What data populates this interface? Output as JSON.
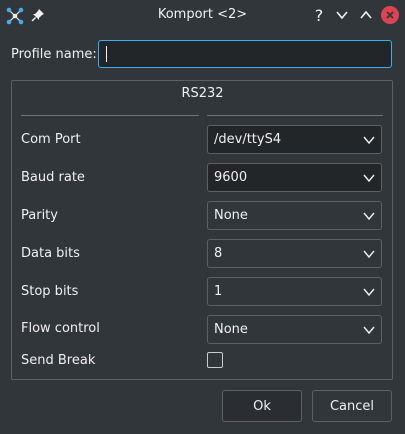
{
  "window": {
    "title": "Komport <2>",
    "app_icon": "network-icon",
    "pin_icon": "pin-icon",
    "help_label": "?",
    "colors": {
      "accent": "#3daee9",
      "close": "#da4453",
      "background": "#31363b"
    }
  },
  "profile": {
    "label": "Profile name:",
    "value": ""
  },
  "group": {
    "title": "RS232",
    "rows": [
      {
        "label": "Com Port",
        "value": "/dev/ttyS4"
      },
      {
        "label": "Baud rate",
        "value": "9600"
      },
      {
        "label": "Parity",
        "value": "None"
      },
      {
        "label": "Data bits",
        "value": "8"
      },
      {
        "label": "Stop bits",
        "value": "1"
      },
      {
        "label": "Flow control",
        "value": "None"
      }
    ],
    "send_break": {
      "label": "Send Break",
      "checked": false
    }
  },
  "buttons": {
    "ok": "Ok",
    "cancel": "Cancel"
  }
}
